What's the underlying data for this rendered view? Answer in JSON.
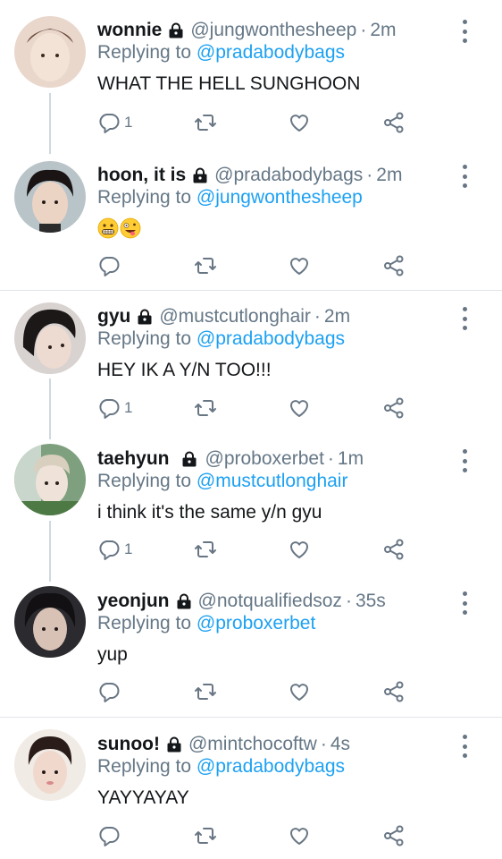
{
  "labels": {
    "replying_prefix": "Replying to",
    "separator": "·"
  },
  "colors": {
    "link": "#1da1f2",
    "muted": "#657786",
    "icon": "#687684",
    "divider": "#e1e5e9"
  },
  "icons": {
    "reply": "speech-bubble-icon",
    "retweet": "retweet-icon",
    "like": "heart-icon",
    "share": "share-icon",
    "lock": "lock-icon",
    "more": "vertical-dots-icon"
  },
  "tweets": [
    {
      "name": "wonnie",
      "handle": "@jungwonthesheep",
      "time": "2m",
      "replying_to": "@pradabodybags",
      "text": "WHAT THE HELL SUNGHOON",
      "reply_count": "1"
    },
    {
      "name": "hoon, it is",
      "handle": "@pradabodybags",
      "time": "2m",
      "replying_to": "@jungwonthesheep",
      "text": "",
      "emojis": [
        "grimacing-face",
        "zany-face"
      ],
      "reply_count": ""
    },
    {
      "name": "gyu",
      "handle": "@mustcutlonghair",
      "time": "2m",
      "replying_to": "@pradabodybags",
      "text": "HEY IK A Y/N TOO!!!",
      "reply_count": "1"
    },
    {
      "name": "taehyun",
      "handle": "@proboxerbet",
      "time": "1m",
      "replying_to": "@mustcutlonghair",
      "text": "i think it's the same y/n gyu",
      "reply_count": "1"
    },
    {
      "name": "yeonjun",
      "handle": "@notqualifiedsoz",
      "time": "35s",
      "replying_to": "@proboxerbet",
      "text": "yup",
      "reply_count": ""
    },
    {
      "name": "sunoo!",
      "handle": "@mintchocoftw",
      "time": "4s",
      "replying_to": "@pradabodybags",
      "text": "YAYYAYAY",
      "reply_count": ""
    }
  ]
}
